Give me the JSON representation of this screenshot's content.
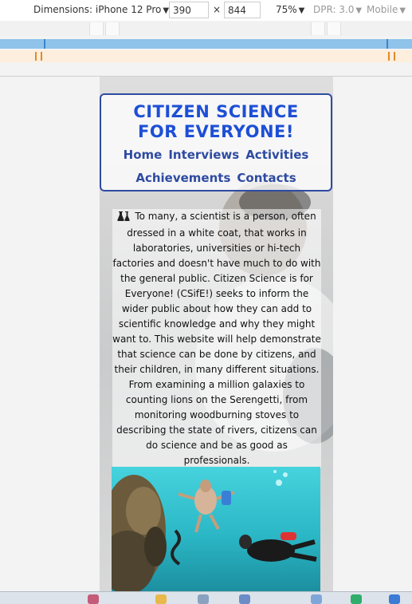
{
  "devtools": {
    "device_label": "Dimensions: iPhone 12 Pro",
    "width_value": "390",
    "times": "×",
    "height_value": "844",
    "zoom": "75%",
    "dpr": "DPR: 3.0",
    "mode": "Mobile"
  },
  "header": {
    "title_line1": "CITIZEN SCIENCE",
    "title_line2": "FOR EVERYONE!",
    "nav": [
      "Home",
      "Interviews",
      "Activities",
      "Achievements",
      "Contacts"
    ]
  },
  "intro": {
    "text": "To many, a scientist is a person, often dressed in a white coat, that works in laboratories, universities or hi-tech factories and doesn't have much to do with the general public. Citizen Science is for Everyone! (CSifE!) seeks to inform the wider public about how they can add to scientific knowledge and why they might want to. This website will help demonstrate that science can be done by citizens, and their children, in many different situations. From examining a million galaxies to counting lions on the Serengetti, from monitoring woodburning stoves to describing the state of rivers, citizens can do science and be as good as professionals."
  },
  "colors": {
    "title": "#1d4fd6",
    "nav": "#2e4ba1",
    "border": "#2e4ba1"
  },
  "icons": {
    "intro": "flask-icon",
    "photo": "diver-photo"
  }
}
